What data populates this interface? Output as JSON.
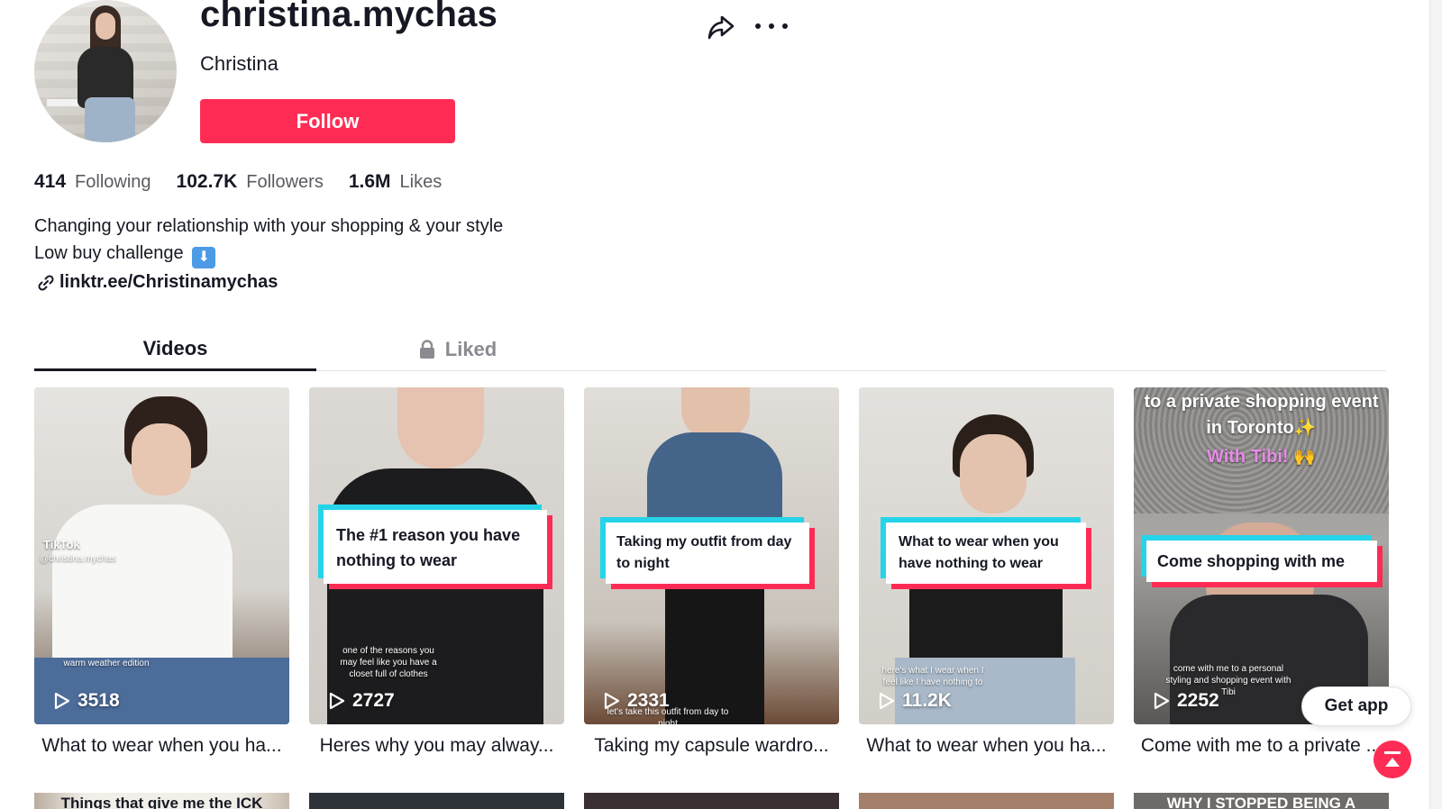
{
  "profile": {
    "username": "christina.mychas",
    "nickname": "Christina",
    "follow_label": "Follow",
    "stats": [
      {
        "value": "414",
        "label": "Following"
      },
      {
        "value": "102.7K",
        "label": "Followers"
      },
      {
        "value": "1.6M",
        "label": "Likes"
      }
    ],
    "bio_line1": "Changing your relationship with your shopping & your style",
    "bio_line2": "Low buy challenge",
    "bio_emoji": "⬇",
    "link": "linktr.ee/Christinamychas"
  },
  "tabs": {
    "videos": "Videos",
    "liked": "Liked"
  },
  "videos": [
    {
      "plays": "3518",
      "title": "What to wear when you ha...",
      "watermark": "TikTok",
      "watermark_handle": "@christina.mychas",
      "overlay_small": "warm weather edition"
    },
    {
      "plays": "2727",
      "title": "Heres why you may alway...",
      "caption": "The #1 reason you have nothing to wear",
      "overlay_small": "one of the reasons you may feel like you have a closet full of clothes"
    },
    {
      "plays": "2331",
      "title": "Taking my capsule wardro...",
      "caption": "Taking my outfit from day to night",
      "overlay_small": "let's take this outfit from day to night"
    },
    {
      "plays": "11.2K",
      "title": "What to wear when you ha...",
      "caption": "What to wear when you have nothing to wear",
      "overlay_small": "here's what I wear when I feel like I have nothing to"
    },
    {
      "plays": "2252",
      "title": "Come with me to a private ...",
      "caption": "Come shopping with me",
      "top_text": "to a private shopping event in Toronto✨",
      "top_text2": "With Tibi! 🙌",
      "overlay_small": "come with me to a personal styling and shopping event with Tibi"
    }
  ],
  "row2": [
    {
      "text": "Things that give me the ICK"
    },
    {
      "text": ""
    },
    {
      "text": ""
    },
    {
      "text": ""
    },
    {
      "text": "WHY I STOPPED BEING A"
    }
  ],
  "get_app_label": "Get app",
  "colors": {
    "brand": "#fe2c55",
    "accent_cyan": "#25d4e9",
    "text": "#161823",
    "muted": "#5a5b62"
  }
}
